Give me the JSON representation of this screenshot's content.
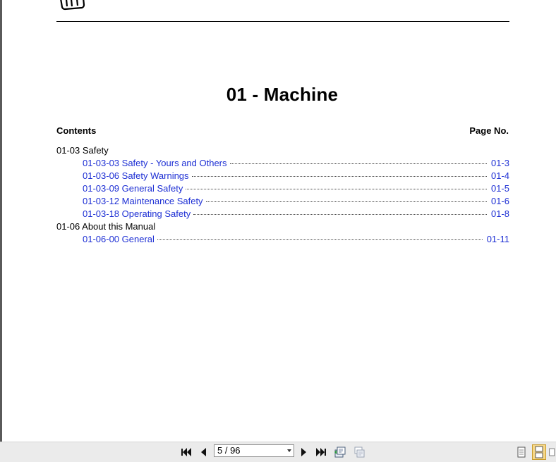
{
  "document": {
    "title": "01 - Machine",
    "contents_label": "Contents",
    "page_no_label": "Page No."
  },
  "toc": {
    "sections": [
      {
        "label": "01-03 Safety",
        "entries": [
          {
            "label": "01-03-03 Safety - Yours and Others",
            "page": "01-3"
          },
          {
            "label": "01-03-06 Safety Warnings",
            "page": "01-4"
          },
          {
            "label": "01-03-09 General Safety",
            "page": "01-5"
          },
          {
            "label": "01-03-12 Maintenance Safety",
            "page": "01-6"
          },
          {
            "label": "01-03-18 Operating Safety",
            "page": "01-8"
          }
        ]
      },
      {
        "label": "01-06 About this Manual",
        "entries": [
          {
            "label": "01-06-00 General",
            "page": "01-11"
          }
        ]
      }
    ]
  },
  "toolbar": {
    "page_indicator": "5 / 96",
    "icons": [
      "first-page-icon",
      "previous-page-icon",
      "next-page-icon",
      "last-page-icon",
      "export-icon",
      "print-icon",
      "single-page-view-icon",
      "continuous-view-icon",
      "two-page-view-icon"
    ]
  },
  "colors": {
    "link": "#1d2fd4",
    "toolbar_bg": "#ebebeb"
  }
}
